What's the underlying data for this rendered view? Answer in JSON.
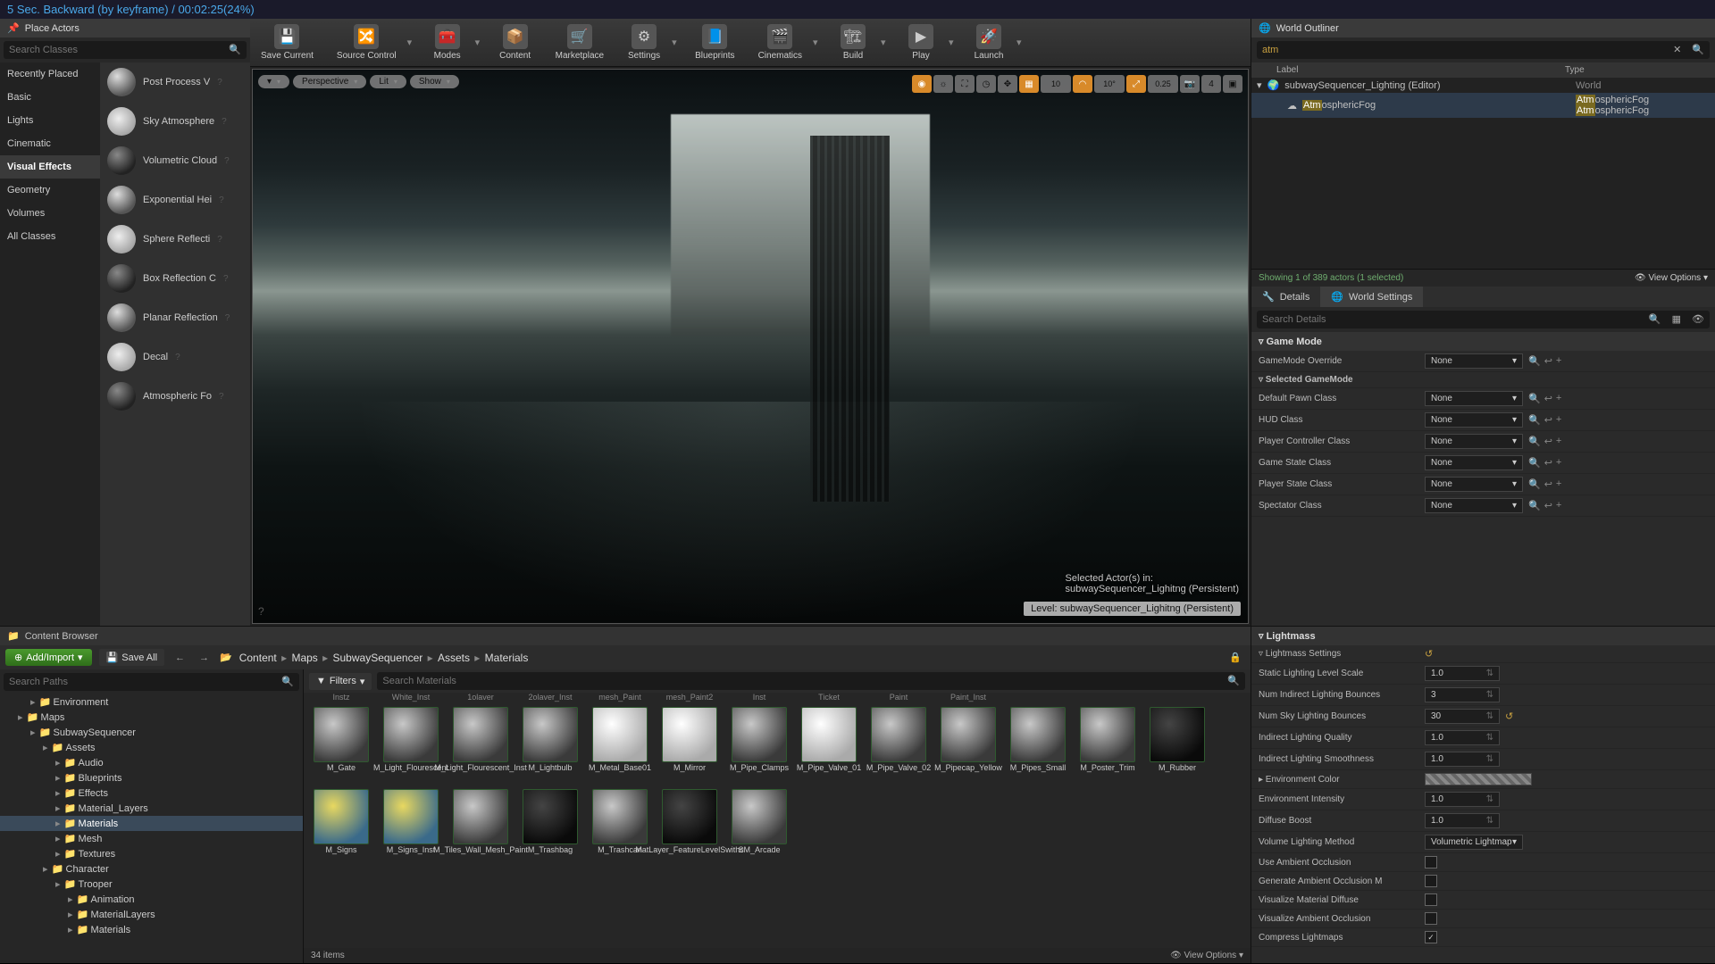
{
  "titlebar": "5 Sec. Backward (by keyframe) / 00:02:25(24%)",
  "place_actors": {
    "title": "Place Actors",
    "search_ph": "Search Classes",
    "cats": [
      "Recently Placed",
      "Basic",
      "Lights",
      "Cinematic",
      "Visual Effects",
      "Geometry",
      "Volumes",
      "All Classes"
    ],
    "active_cat": "Visual Effects",
    "items": [
      {
        "label": "Post Process V"
      },
      {
        "label": "Sky Atmosphere"
      },
      {
        "label": "Volumetric Cloud"
      },
      {
        "label": "Exponential Hei"
      },
      {
        "label": "Sphere Reflecti"
      },
      {
        "label": "Box Reflection C"
      },
      {
        "label": "Planar Reflection"
      },
      {
        "label": "Decal"
      },
      {
        "label": "Atmospheric Fo"
      }
    ]
  },
  "toolbar": {
    "items": [
      "Save Current",
      "Source Control",
      "Modes",
      "Content",
      "Marketplace",
      "Settings",
      "Blueprints",
      "Cinematics",
      "Build",
      "Play",
      "Launch"
    ]
  },
  "viewport": {
    "perspective": "Perspective",
    "lit": "Lit",
    "show": "Show",
    "snap_a": "10",
    "snap_b": "10°",
    "snap_c": "0.25",
    "snap_d": "4",
    "overlay1": "Selected Actor(s) in:",
    "overlay2": "subwaySequencer_Lighitng (Persistent)",
    "level_label": "Level:  subwaySequencer_Lighitng (Persistent)"
  },
  "outliner": {
    "title": "World Outliner",
    "search_value": "atm",
    "col_label": "Label",
    "col_type": "Type",
    "row1_label": "subwaySequencer_Lighting (Editor)",
    "row1_type": "World",
    "row2_prefix": "Atm",
    "row2_rest": "osphericFog",
    "row2_type_prefix": "Atm",
    "row2_type_rest": "osphericFog",
    "status": "Showing 1 of 389 actors (1 selected)",
    "view_options": "View Options"
  },
  "details_tabs": {
    "details": "Details",
    "world": "World Settings"
  },
  "details_search_ph": "Search Details",
  "world_settings": {
    "game_mode": "Game Mode",
    "gm_override": "GameMode Override",
    "sel_gm": "Selected GameMode",
    "def_pawn": "Default Pawn Class",
    "hud": "HUD Class",
    "pcc": "Player Controller Class",
    "gsc": "Game State Class",
    "psc": "Player State Class",
    "spc": "Spectator Class",
    "none": "None",
    "lightmass": "Lightmass",
    "lm_settings": "Lightmass Settings",
    "static_scale": "Static Lighting Level Scale",
    "static_scale_v": "1.0",
    "num_indirect": "Num Indirect Lighting Bounces",
    "num_indirect_v": "3",
    "num_sky": "Num Sky Lighting Bounces",
    "num_sky_v": "30",
    "ilq": "Indirect Lighting Quality",
    "ilq_v": "1.0",
    "ils": "Indirect Lighting Smoothness",
    "ils_v": "1.0",
    "env_color": "Environment Color",
    "env_intensity": "Environment Intensity",
    "env_intensity_v": "1.0",
    "diffuse": "Diffuse Boost",
    "diffuse_v": "1.0",
    "vlm": "Volume Lighting Method",
    "vlm_v": "Volumetric Lightmap",
    "uao": "Use Ambient Occlusion",
    "gaom": "Generate Ambient Occlusion M",
    "vmd": "Visualize Material Diffuse",
    "vao": "Visualize Ambient Occlusion",
    "clm": "Compress Lightmaps"
  },
  "content_browser": {
    "title": "Content Browser",
    "add": "Add/Import",
    "save_all": "Save All",
    "crumbs": [
      "Content",
      "Maps",
      "SubwaySequencer",
      "Assets",
      "Materials"
    ],
    "search_paths_ph": "Search Paths",
    "filters": "Filters",
    "search_assets_ph": "Search Materials",
    "tree": [
      {
        "label": "Environment",
        "depth": 2
      },
      {
        "label": "Maps",
        "depth": 1
      },
      {
        "label": "SubwaySequencer",
        "depth": 2
      },
      {
        "label": "Assets",
        "depth": 3
      },
      {
        "label": "Audio",
        "depth": 4
      },
      {
        "label": "Blueprints",
        "depth": 4
      },
      {
        "label": "Effects",
        "depth": 4
      },
      {
        "label": "Material_Layers",
        "depth": 4
      },
      {
        "label": "Materials",
        "depth": 4,
        "sel": true
      },
      {
        "label": "Mesh",
        "depth": 4
      },
      {
        "label": "Textures",
        "depth": 4
      },
      {
        "label": "Character",
        "depth": 3
      },
      {
        "label": "Trooper",
        "depth": 4
      },
      {
        "label": "Animation",
        "depth": 5
      },
      {
        "label": "MaterialLayers",
        "depth": 5
      },
      {
        "label": "Materials",
        "depth": 5
      }
    ],
    "top_labels": [
      "Instz",
      "White_Inst",
      "1olaver",
      "2olaver_Inst",
      "mesh_Paint",
      "mesh_Paint2",
      "Inst",
      "Ticket",
      "Paint",
      "Paint_Inst"
    ],
    "assets": [
      {
        "label": "M_Gate"
      },
      {
        "label": "M_Light_Flourescent"
      },
      {
        "label": "M_Light_Flourescent_Inst"
      },
      {
        "label": "M_Lightbulb"
      },
      {
        "label": "M_Metal_Base01",
        "cls": "bright"
      },
      {
        "label": "M_Mirror",
        "cls": "bright"
      },
      {
        "label": "M_Pipe_Clamps"
      },
      {
        "label": "M_Pipe_Valve_01",
        "cls": "bright"
      },
      {
        "label": "M_Pipe_Valve_02"
      },
      {
        "label": "M_Pipecap_Yellow"
      },
      {
        "label": "M_Pipes_Small"
      },
      {
        "label": "M_Poster_Trim"
      },
      {
        "label": "M_Rubber",
        "cls": "dark"
      },
      {
        "label": "M_Signs",
        "cls": "color"
      },
      {
        "label": "M_Signs_Inst",
        "cls": "color"
      },
      {
        "label": "M_Tiles_Wall_Mesh_Paint"
      },
      {
        "label": "M_Trashbag",
        "cls": "dark"
      },
      {
        "label": "M_Trashcan"
      },
      {
        "label": "MatLayer_FeatureLevelSwithc",
        "cls": "dark"
      },
      {
        "label": "SM_Arcade"
      }
    ],
    "count": "34 items",
    "view_options": "View Options"
  }
}
